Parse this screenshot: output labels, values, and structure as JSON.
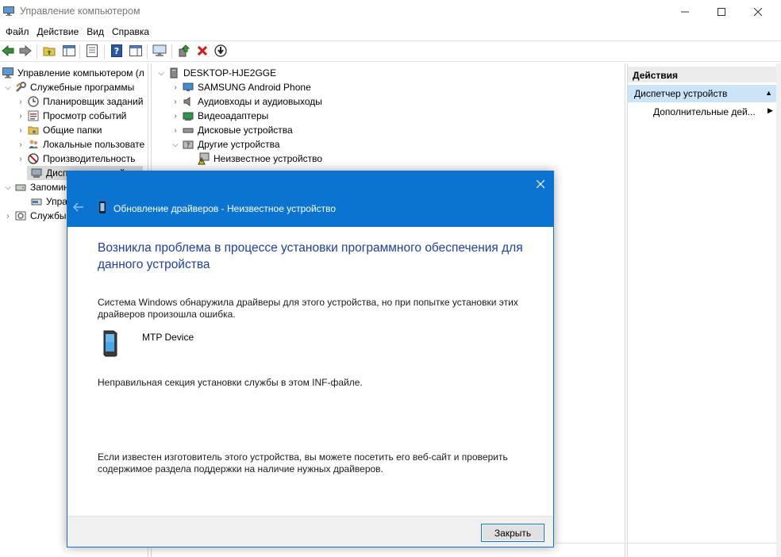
{
  "window": {
    "title": "Управление компьютером"
  },
  "menu": [
    "Файл",
    "Действие",
    "Вид",
    "Справка"
  ],
  "left_tree": [
    {
      "label": "Управление компьютером (л",
      "icon": "computer-management-icon"
    },
    {
      "label": "Служебные программы",
      "icon": "tools-icon"
    },
    {
      "label": "Планировщик заданий",
      "icon": "clock-icon"
    },
    {
      "label": "Просмотр событий",
      "icon": "event-viewer-icon"
    },
    {
      "label": "Общие папки",
      "icon": "shared-folder-icon"
    },
    {
      "label": "Локальные пользовате",
      "icon": "users-icon"
    },
    {
      "label": "Производительность",
      "icon": "performance-icon"
    },
    {
      "label": "Диспетчер устройств",
      "icon": "device-manager-icon"
    },
    {
      "label": "Запоминающие устройства",
      "icon": "storage-icon"
    },
    {
      "label": "Управление дисками",
      "icon": "disk-management-icon"
    },
    {
      "label": "Службы и приложения",
      "icon": "services-icon"
    }
  ],
  "device_tree": {
    "root": "DESKTOP-HJE2GGE",
    "items": [
      {
        "label": "SAMSUNG Android Phone",
        "icon": "monitor-icon"
      },
      {
        "label": "Аудиовходы и аудиовыходы",
        "icon": "speaker-icon"
      },
      {
        "label": "Видеоадаптеры",
        "icon": "display-adapter-icon"
      },
      {
        "label": "Дисковые устройства",
        "icon": "disk-drive-icon"
      },
      {
        "label": "Другие устройства",
        "icon": "other-devices-icon"
      },
      {
        "label": "Неизвестное устройство",
        "icon": "warning-device-icon"
      }
    ]
  },
  "actions": {
    "header": "Действия",
    "section": "Диспетчер устройств",
    "more": "Дополнительные дей..."
  },
  "dialog": {
    "title": "Обновление драйверов - Неизвестное устройство",
    "heading": "Возникла проблема в процессе установки программного обеспечения для данного устройства",
    "message": "Система Windows обнаружила драйверы для этого устройства, но при попытке установки этих драйверов произошла ошибка.",
    "device_name": "MTP Device",
    "error": "Неправильная секция установки службы в этом INF-файле.",
    "advice": "Если известен изготовитель этого устройства, вы можете посетить его веб-сайт и проверить содержимое раздела поддержки на наличие нужных драйверов.",
    "close_button": "Закрыть"
  },
  "colors": {
    "dialog_titlebar": "#0a74d0",
    "heading": "#1e3f9e",
    "selection": "#cce4f7",
    "delete_red": "#d11818"
  }
}
